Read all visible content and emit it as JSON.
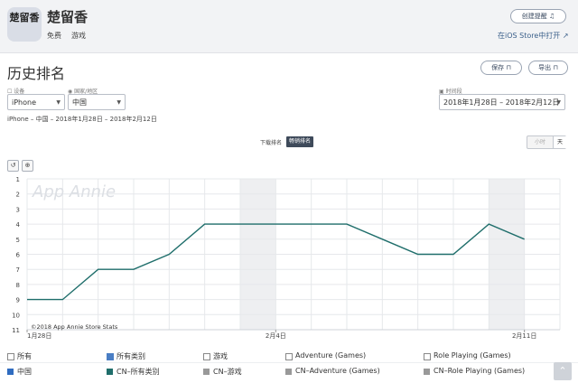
{
  "header": {
    "app_icon_text": "楚留香",
    "app_name": "楚留香",
    "price": "免费",
    "genre": "游戏",
    "create_alert_label": "创建提醒",
    "ios_store_label": "在iOS Store中打开"
  },
  "page": {
    "title": "历史排名",
    "save_label": "保存",
    "export_label": "导出"
  },
  "filters": {
    "device_label": "设备",
    "device_value": "iPhone",
    "country_label": "国家/地区",
    "country_value": "中国",
    "date_label": "时间段",
    "date_value": "2018年1月28日 – 2018年2月12日",
    "summary": "iPhone – 中国 – 2018年1月28日 – 2018年2月12日"
  },
  "toggles": {
    "download_rank": "下载排名",
    "grossing_rank": "畅销排名",
    "hour": "小时",
    "day": "天"
  },
  "chart_data": {
    "type": "line",
    "title": "",
    "xlabel": "",
    "ylabel": "",
    "watermark": "App Annie",
    "copyright": "©2018 App Annie Store Stats",
    "x_tick_labels": [
      "1月28日",
      "2月4日",
      "2月11日"
    ],
    "y_ticks": [
      1,
      2,
      3,
      4,
      5,
      6,
      7,
      8,
      9,
      10,
      11
    ],
    "ylim": [
      1,
      11
    ],
    "y_reversed": true,
    "x": [
      "1月28日",
      "1月29日",
      "1月30日",
      "1月31日",
      "2月1日",
      "2月2日",
      "2月3日",
      "2月4日",
      "2月5日",
      "2月6日",
      "2月7日",
      "2月8日",
      "2月9日",
      "2月10日",
      "2月11日",
      "2月12日"
    ],
    "series": [
      {
        "name": "CN–所有类别",
        "color": "#1f6e6b",
        "values": [
          9,
          9,
          7,
          7,
          6,
          4,
          4,
          4,
          4,
          4,
          5,
          6,
          6,
          4,
          5
        ]
      }
    ],
    "weekend_bands": [
      [
        "1月27日",
        "1月28日"
      ],
      [
        "2月3日",
        "2月4日"
      ],
      [
        "2月10日",
        "2月11日"
      ]
    ]
  },
  "legend": {
    "row1": [
      "所有",
      "所有类别",
      "游戏",
      "Adventure (Games)",
      "Role Playing (Games)"
    ],
    "row1_checked": [
      false,
      true,
      false,
      false,
      false
    ],
    "row2": [
      "中国",
      "CN–所有类别",
      "CN–游戏",
      "CN–Adventure (Games)",
      "CN–Role Playing (Games)"
    ],
    "row2_colors": [
      "#2f6cc0",
      "#1f6e6b",
      "#999999",
      "#999999",
      "#999999"
    ],
    "scroll_top": "⌃"
  }
}
